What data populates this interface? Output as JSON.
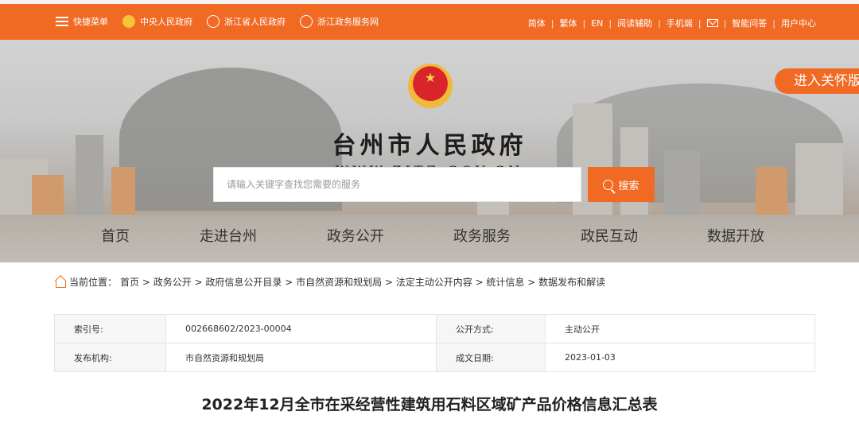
{
  "topbar": {
    "links": [
      {
        "label": "快捷菜单",
        "icon": "menu-icon"
      },
      {
        "label": "中央人民政府",
        "icon": "national-emblem-icon"
      },
      {
        "label": "浙江省人民政府",
        "icon": "zhejiang-emblem-icon"
      },
      {
        "label": "浙江政务服务网",
        "icon": "service-emblem-icon"
      }
    ],
    "right_links": [
      "简体",
      "繁体",
      "EN",
      "阅读辅助",
      "手机端",
      "智能问答",
      "用户中心"
    ]
  },
  "banner": {
    "title": "台州市人民政府",
    "url": "WWW.ZJTZ.GOV.CN",
    "care_button": "进入关怀版"
  },
  "search": {
    "placeholder": "请输入关键字查找您需要的服务",
    "button": "搜索"
  },
  "nav": [
    "首页",
    "走进台州",
    "政务公开",
    "政务服务",
    "政民互动",
    "数据开放"
  ],
  "breadcrumb": {
    "prefix": "当前位置：",
    "path": "首页 > 政务公开 > 政府信息公开目录 > 市自然资源和规划局 > 法定主动公开内容 > 统计信息 > 数据发布和解读"
  },
  "meta": {
    "rows": [
      {
        "k1": "索引号:",
        "v1": "002668602/2023-00004",
        "k2": "公开方式:",
        "v2": "主动公开"
      },
      {
        "k1": "发布机构:",
        "v1": "市自然资源和规划局",
        "k2": "成文日期:",
        "v2": "2023-01-03"
      }
    ]
  },
  "document": {
    "title": "2022年12月全市在采经营性建筑用石料区域矿产品价格信息汇总表"
  },
  "colors": {
    "accent": "#f06a23"
  }
}
